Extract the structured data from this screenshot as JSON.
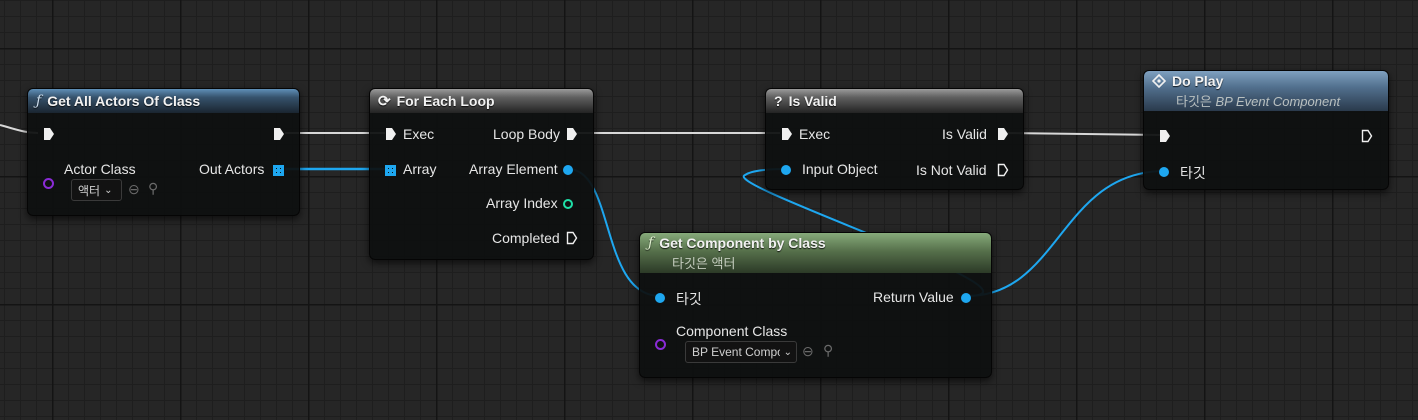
{
  "nodes": {
    "get_all_actors": {
      "title": "Get All Actors Of Class",
      "actor_class_label": "Actor Class",
      "actor_class_value": "액터",
      "out_actors_label": "Out Actors"
    },
    "for_each_loop": {
      "title": "For Each Loop",
      "exec_label": "Exec",
      "loop_body_label": "Loop Body",
      "array_label": "Array",
      "array_element_label": "Array Element",
      "array_index_label": "Array Index",
      "completed_label": "Completed"
    },
    "is_valid": {
      "title": "Is Valid",
      "exec_label": "Exec",
      "is_valid_label": "Is Valid",
      "input_object_label": "Input Object",
      "is_not_valid_label": "Is Not Valid"
    },
    "do_play": {
      "title": "Do Play",
      "subtitle_prefix": "타깃은",
      "subtitle_target": "BP Event Component",
      "target_label": "타깃"
    },
    "get_component": {
      "title": "Get Component by Class",
      "subtitle": "타깃은 액터",
      "target_label": "타깃",
      "return_value_label": "Return Value",
      "component_class_label": "Component Class",
      "component_class_value": "BP Event Compo"
    }
  },
  "icons": {
    "function": "function-icon",
    "loop": "loop-icon",
    "question": "question-icon",
    "event": "event-diamond-icon",
    "browse": "browse-arrow-icon",
    "search": "search-icon",
    "dropdown": "chevron-down-icon"
  },
  "colors": {
    "exec_wire": "#d8d8d8",
    "object_wire": "#1ea7f0",
    "class_pin": "#8a2bd6",
    "integer_pin": "#1fe0a8",
    "function_header": "#36526c",
    "macro_header": "#5f5f5f",
    "event_header": "#52708e",
    "pure_function_header": "#56704b"
  }
}
